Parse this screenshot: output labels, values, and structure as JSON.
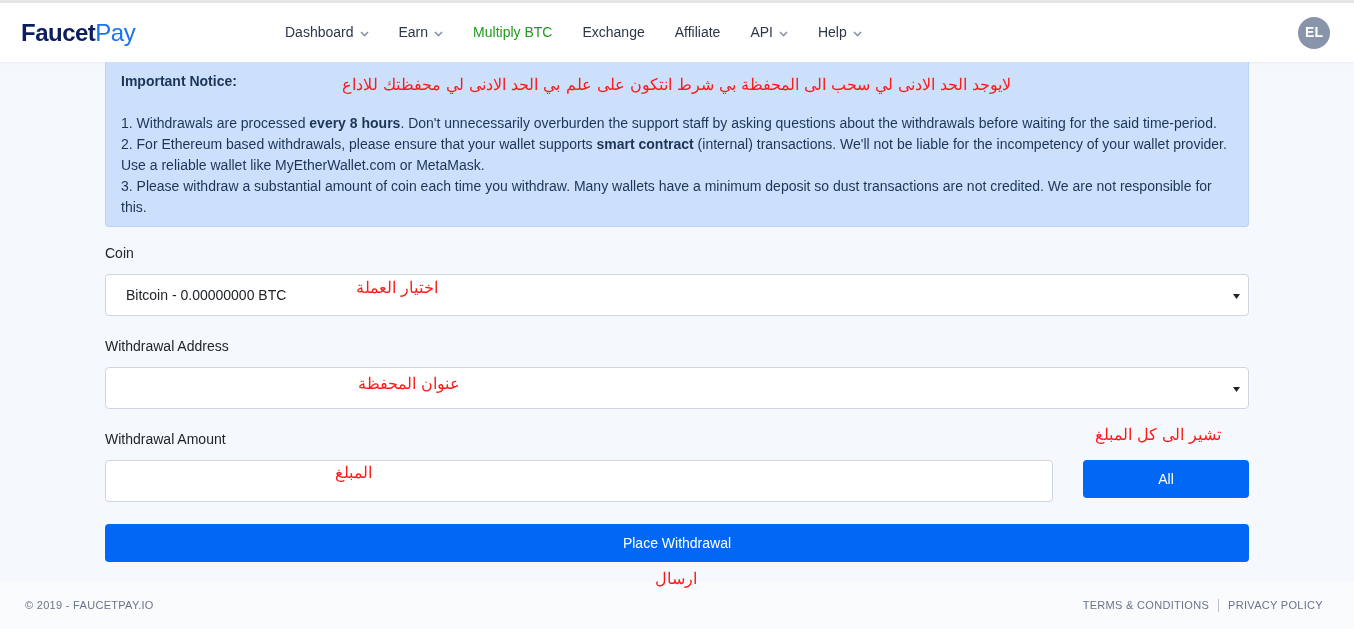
{
  "header": {
    "logo": {
      "part1": "Faucet",
      "part2": "Pay"
    },
    "nav": [
      {
        "label": "Dashboard",
        "dropdown": true,
        "highlighted": false
      },
      {
        "label": "Earn",
        "dropdown": true,
        "highlighted": false
      },
      {
        "label": "Multiply BTC",
        "dropdown": false,
        "highlighted": true
      },
      {
        "label": "Exchange",
        "dropdown": false,
        "highlighted": false
      },
      {
        "label": "Affiliate",
        "dropdown": false,
        "highlighted": false
      },
      {
        "label": "API",
        "dropdown": true,
        "highlighted": false
      },
      {
        "label": "Help",
        "dropdown": true,
        "highlighted": false
      }
    ],
    "avatar": "EL"
  },
  "notice": {
    "title": "Important Notice:",
    "annotation": "لايوجد الحد الادنى لي سحب الى المحفظة بي شرط انتكون على علم بي الحد الادنى لي محفظتك للاداع",
    "items": [
      "1. Withdrawals are processed **every 8 hours**. Don't unnecessarily overburden the support staff by asking questions about the withdrawals before waiting for the said time-period.",
      "2. For Ethereum based withdrawals, please ensure that your wallet supports **smart contract** (internal) transactions. We'll not be liable for the incompetency of your wallet provider. Use a reliable wallet like MyEtherWallet.com or MetaMask.",
      "3. Please withdraw a substantial amount of coin each time you withdraw. Many wallets have a minimum deposit so dust transactions are not credited. We are not responsible for this."
    ]
  },
  "coin": {
    "label": "Coin",
    "value": "Bitcoin - 0.00000000 BTC",
    "annotation": "اختيار العملة"
  },
  "address": {
    "label": "Withdrawal Address",
    "annotation": "عنوان المحفظة"
  },
  "amount": {
    "label": "Withdrawal Amount",
    "annotation": "المبلغ",
    "all_button": "All",
    "all_annotation": "تشير الى كل المبلغ"
  },
  "submit": {
    "label": "Place Withdrawal",
    "annotation": "ارسال"
  },
  "footer": {
    "copyright": "© 2019 - FAUCETPAY.IO",
    "links": [
      "TERMS & CONDITIONS",
      "PRIVACY POLICY"
    ]
  }
}
